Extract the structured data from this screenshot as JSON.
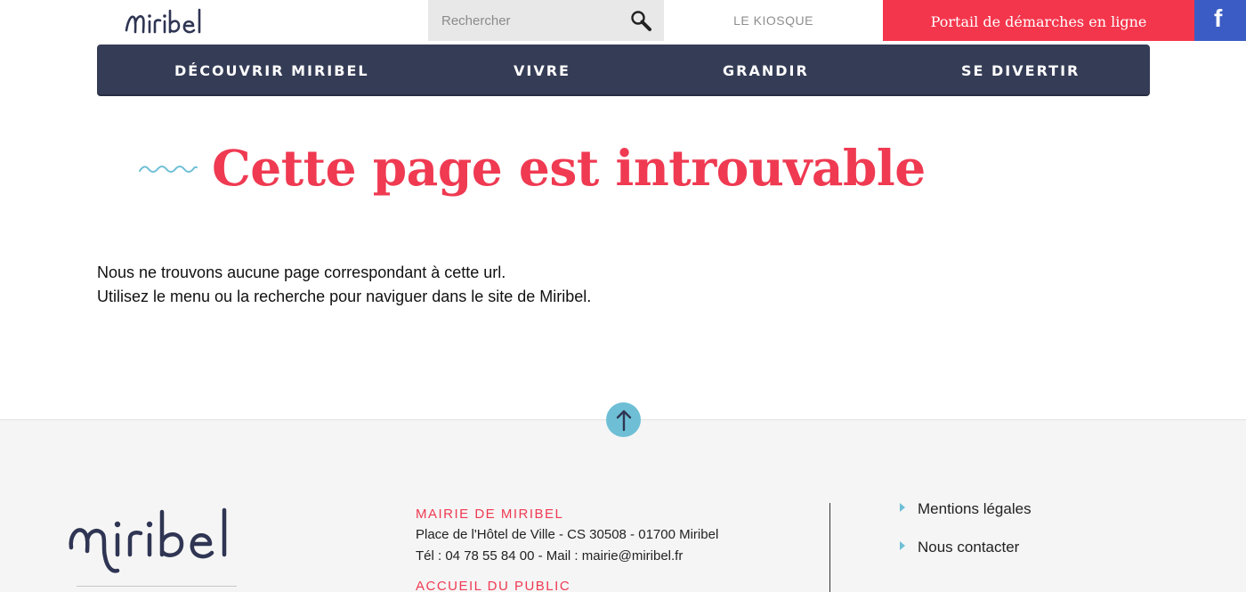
{
  "header": {
    "logo_text": "Miribel",
    "search_placeholder": "Rechercher",
    "kiosque_label": "LE KIOSQUE",
    "portail_label": "Portail de démarches en ligne",
    "facebook_label": "f"
  },
  "nav": {
    "items": [
      {
        "label": "DÉCOUVRIR MIRIBEL"
      },
      {
        "label": "VIVRE"
      },
      {
        "label": "GRANDIR"
      },
      {
        "label": "SE DIVERTIR"
      }
    ]
  },
  "main": {
    "title": "Cette page est introuvable",
    "message_line1": "Nous ne trouvons aucune page correspondant à cette url.",
    "message_line2": "Utilisez le menu ou la recherche pour naviguer dans le site de Miribel."
  },
  "footer": {
    "logo_text": "miribel",
    "mairie_title": "MAIRIE DE MIRIBEL",
    "mairie_address": "Place de l'Hôtel de Ville - CS 30508 - 01700 Miribel",
    "mairie_contact": "Tél : 04 78 55 84 00 - Mail : mairie@miribel.fr",
    "accueil_title": "ACCUEIL DU PUBLIC",
    "links": [
      {
        "label": "Mentions légales"
      },
      {
        "label": "Nous contacter"
      }
    ]
  },
  "colors": {
    "nav_bg": "#353c56",
    "accent_red": "#ef3a52",
    "portail_red": "#f4364c",
    "facebook_blue": "#3b5cc4",
    "accent_cyan": "#6ebfd6",
    "footer_bg": "#f5f5f5"
  },
  "icons": {
    "search": "search-icon",
    "facebook": "facebook-icon",
    "back_to_top": "arrow-up-icon",
    "wave": "wave-icon",
    "link_bullet": "triangle-right-icon"
  }
}
